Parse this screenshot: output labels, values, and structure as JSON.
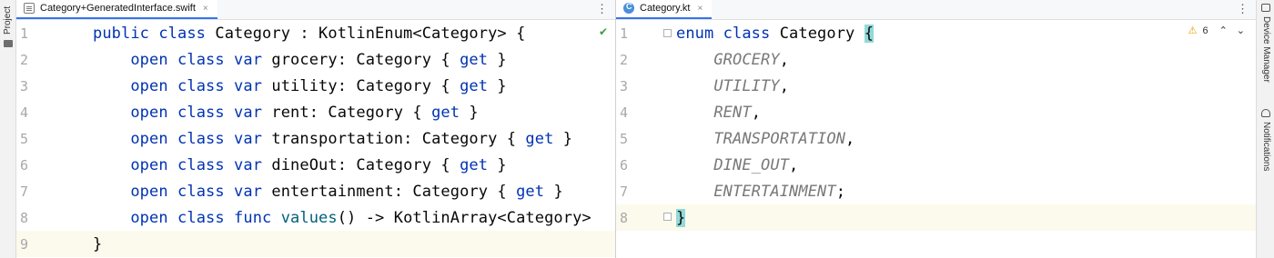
{
  "sidebar_left": {
    "project_label": "Project"
  },
  "sidebar_right": {
    "device_manager_label": "Device Manager",
    "notifications_label": "Notifications"
  },
  "left_editor": {
    "tab_title": "Category+GeneratedInterface.swift",
    "tab_close": "×",
    "menu_glyph": "⋮",
    "check_glyph": "✔",
    "lines": [
      {
        "num": "1",
        "parts": [
          [
            "kw",
            "public class "
          ],
          [
            "",
            "Category : KotlinEnum<Category> {"
          ]
        ]
      },
      {
        "num": "2",
        "parts": [
          [
            "",
            "    "
          ],
          [
            "kw",
            "open class var "
          ],
          [
            "",
            "grocery: Category { "
          ],
          [
            "kw",
            "get"
          ],
          [
            "",
            " }"
          ]
        ]
      },
      {
        "num": "3",
        "parts": [
          [
            "",
            "    "
          ],
          [
            "kw",
            "open class var "
          ],
          [
            "",
            "utility: Category { "
          ],
          [
            "kw",
            "get"
          ],
          [
            "",
            " }"
          ]
        ]
      },
      {
        "num": "4",
        "parts": [
          [
            "",
            "    "
          ],
          [
            "kw",
            "open class var "
          ],
          [
            "",
            "rent: Category { "
          ],
          [
            "kw",
            "get"
          ],
          [
            "",
            " }"
          ]
        ]
      },
      {
        "num": "5",
        "parts": [
          [
            "",
            "    "
          ],
          [
            "kw",
            "open class var "
          ],
          [
            "",
            "transportation: Category { "
          ],
          [
            "kw",
            "get"
          ],
          [
            "",
            " }"
          ]
        ]
      },
      {
        "num": "6",
        "parts": [
          [
            "",
            "    "
          ],
          [
            "kw",
            "open class var "
          ],
          [
            "",
            "dineOut: Category { "
          ],
          [
            "kw",
            "get"
          ],
          [
            "",
            " }"
          ]
        ]
      },
      {
        "num": "7",
        "parts": [
          [
            "",
            "    "
          ],
          [
            "kw",
            "open class var "
          ],
          [
            "",
            "entertainment: Category { "
          ],
          [
            "kw",
            "get"
          ],
          [
            "",
            " }"
          ]
        ]
      },
      {
        "num": "8",
        "parts": [
          [
            "",
            "    "
          ],
          [
            "kw",
            "open class func "
          ],
          [
            "fn",
            "values"
          ],
          [
            "",
            "() -> KotlinArray<Category>"
          ]
        ]
      },
      {
        "num": "9",
        "parts": [
          [
            "",
            "}"
          ]
        ]
      }
    ]
  },
  "right_editor": {
    "tab_title": "Category.kt",
    "tab_close": "×",
    "menu_glyph": "⋮",
    "warning_count": "6",
    "warning_glyph": "⚠",
    "nav_up": "⌃",
    "nav_down": "⌄",
    "lines": [
      {
        "num": "1",
        "parts": [
          [
            "kw",
            "enum class "
          ],
          [
            "",
            "Category "
          ],
          [
            "hl",
            "{"
          ]
        ]
      },
      {
        "num": "2",
        "parts": [
          [
            "",
            "    "
          ],
          [
            "en",
            "GROCERY"
          ],
          [
            "",
            ","
          ]
        ]
      },
      {
        "num": "3",
        "parts": [
          [
            "",
            "    "
          ],
          [
            "en",
            "UTILITY"
          ],
          [
            "",
            ","
          ]
        ]
      },
      {
        "num": "4",
        "parts": [
          [
            "",
            "    "
          ],
          [
            "en",
            "RENT"
          ],
          [
            "",
            ","
          ]
        ]
      },
      {
        "num": "5",
        "parts": [
          [
            "",
            "    "
          ],
          [
            "en",
            "TRANSPORTATION"
          ],
          [
            "",
            ","
          ]
        ]
      },
      {
        "num": "6",
        "parts": [
          [
            "",
            "    "
          ],
          [
            "en",
            "DINE_OUT"
          ],
          [
            "",
            ","
          ]
        ]
      },
      {
        "num": "7",
        "parts": [
          [
            "",
            "    "
          ],
          [
            "en",
            "ENTERTAINMENT"
          ],
          [
            "",
            ";"
          ]
        ]
      },
      {
        "num": "8",
        "parts": [
          [
            "hl",
            "}"
          ]
        ]
      }
    ]
  },
  "colors": {
    "keyword": "#0033b3",
    "function": "#00627a",
    "enum_entry": "#787878",
    "current_line": "#fcfaed",
    "brace_highlight": "#93d9d9",
    "tab_underline": "#3574f0"
  },
  "icons": [
    "swift-file-icon",
    "kotlin-class-icon",
    "kebab-menu-icon",
    "check-icon",
    "warning-icon",
    "chevron-up-icon",
    "chevron-down-icon",
    "folder-icon",
    "device-icon",
    "bell-icon"
  ]
}
